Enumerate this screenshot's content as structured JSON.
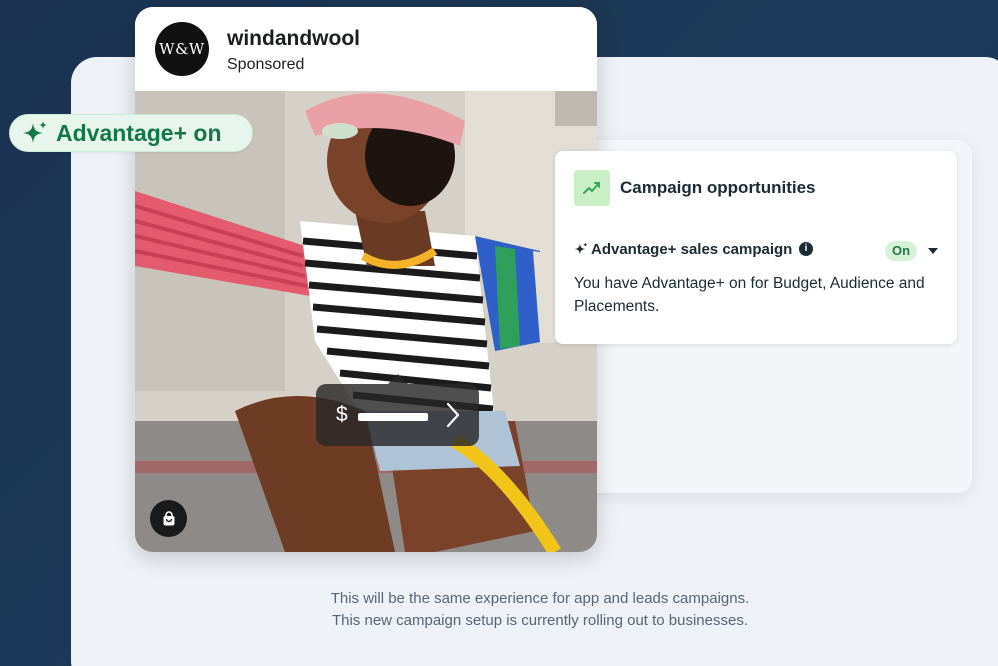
{
  "ad": {
    "avatar_text": "W&W",
    "brand_name": "windandwool",
    "sponsored_label": "Sponsored",
    "price_symbol": "$"
  },
  "badge": {
    "label": "Advantage+ on",
    "color": "#127849"
  },
  "opportunities": {
    "title": "Campaign opportunities",
    "campaign_label": "Advantage+ sales campaign",
    "info_glyph": "i",
    "status": "On",
    "description": "You have Advantage+ on for Budget, Audience and Placements."
  },
  "footnote": {
    "line1": "This will be the same experience for app and leads campaigns.",
    "line2": "This new campaign setup is currently rolling out to businesses."
  },
  "icons": [
    "sparkle-icon",
    "chevron-right-icon",
    "shopping-bag-icon",
    "trend-chart-icon",
    "info-icon",
    "caret-down-icon"
  ]
}
